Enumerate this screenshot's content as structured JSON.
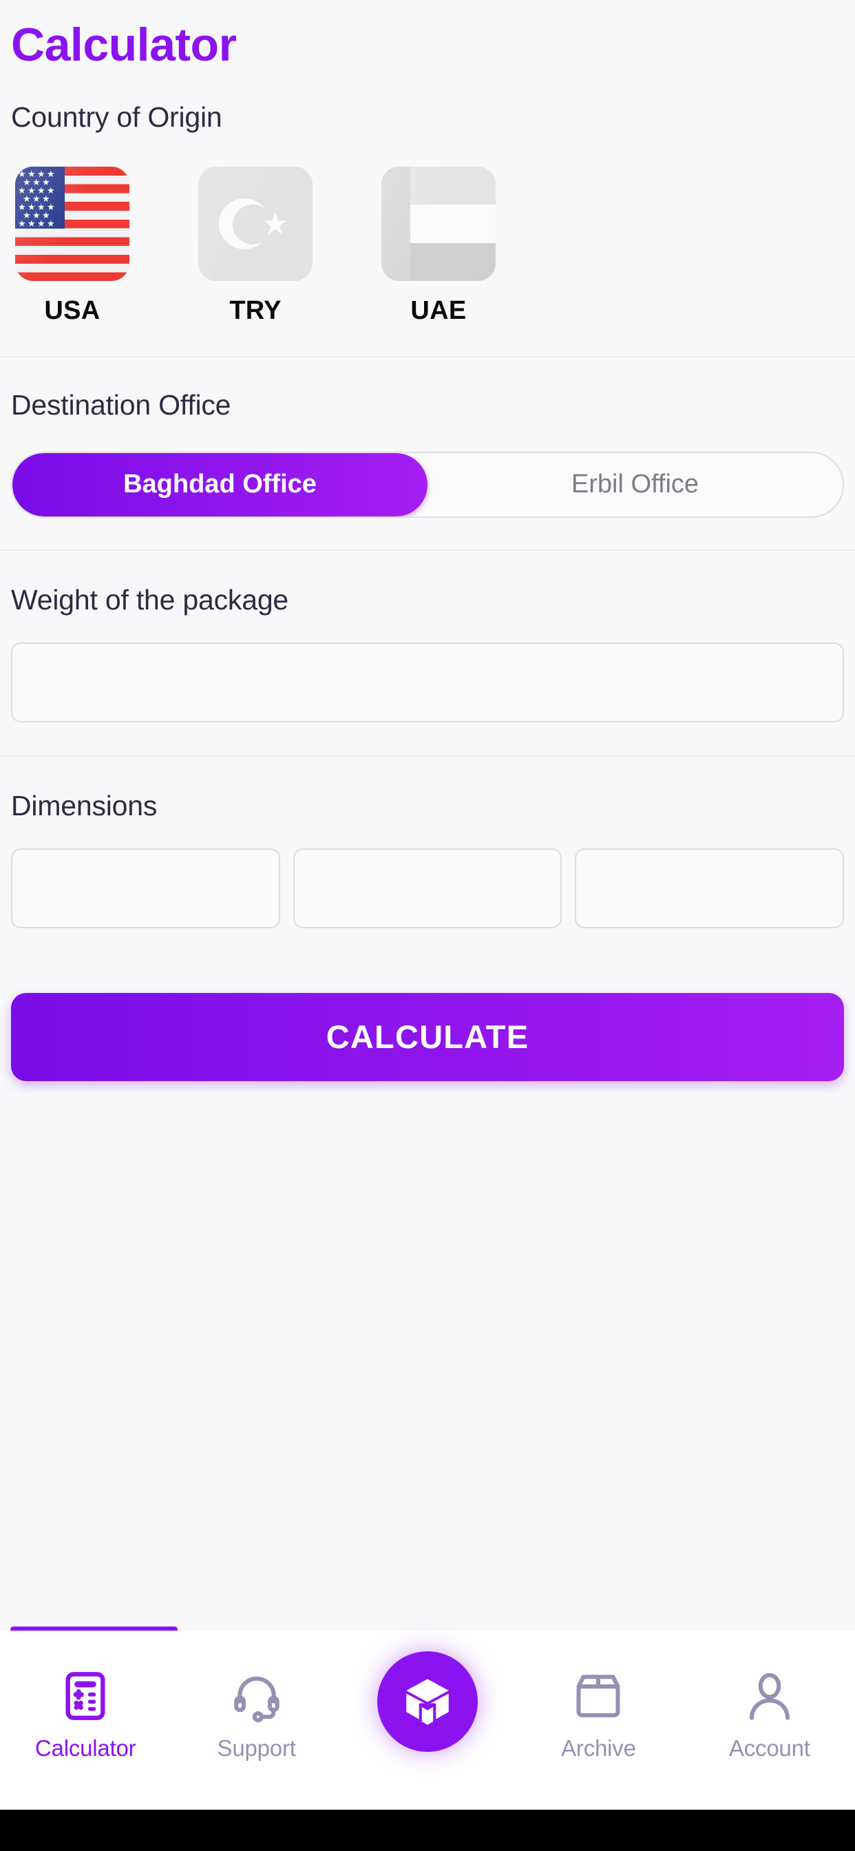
{
  "header": {
    "title": "Calculator"
  },
  "country": {
    "label": "Country of Origin",
    "options": [
      {
        "code": "USA",
        "icon": "usa-flag-icon",
        "selected": true
      },
      {
        "code": "TRY",
        "icon": "turkey-flag-icon",
        "selected": false
      },
      {
        "code": "UAE",
        "icon": "uae-flag-icon",
        "selected": false
      }
    ]
  },
  "destination": {
    "label": "Destination Office",
    "options": [
      {
        "label": "Baghdad Office",
        "selected": true
      },
      {
        "label": "Erbil Office",
        "selected": false
      }
    ]
  },
  "weight": {
    "label": "Weight of the package",
    "value": "",
    "placeholder": ""
  },
  "dimensions": {
    "label": "Dimensions",
    "fields": [
      {
        "value": "",
        "placeholder": ""
      },
      {
        "value": "",
        "placeholder": ""
      },
      {
        "value": "",
        "placeholder": ""
      }
    ]
  },
  "actions": {
    "calculate_label": "CALCULATE"
  },
  "bottom_nav": {
    "items": [
      {
        "label": "Calculator",
        "icon": "calculator-icon",
        "active": true
      },
      {
        "label": "Support",
        "icon": "headset-icon",
        "active": false
      },
      {
        "label": "",
        "icon": "package-cube-logo-icon",
        "active": false
      },
      {
        "label": "Archive",
        "icon": "box-icon",
        "active": false
      },
      {
        "label": "Account",
        "icon": "person-icon",
        "active": false
      }
    ]
  },
  "colors": {
    "brand_purple": "#8b13f0",
    "gradient_start": "#7a0ce8",
    "gradient_end": "#a51ef2",
    "text_dark": "#2b2b45",
    "text_muted": "#9690b4",
    "background": "#f8f8fa"
  }
}
